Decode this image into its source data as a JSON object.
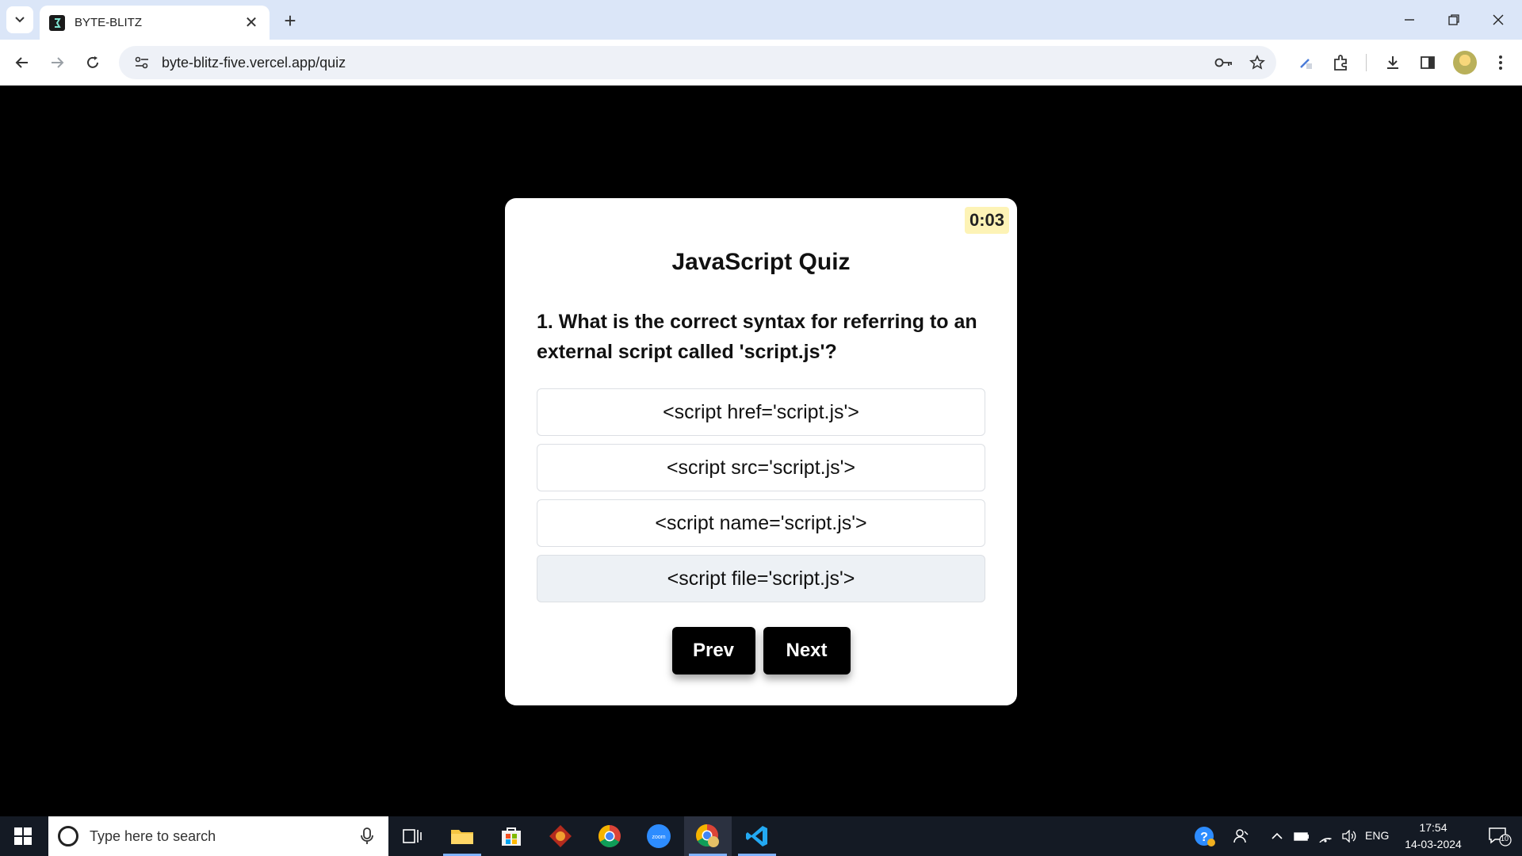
{
  "browser": {
    "tab_title": "BYTE-BLITZ",
    "tab_close": "✕",
    "new_tab": "+",
    "url": "byte-blitz-five.vercel.app/quiz"
  },
  "quiz": {
    "timer": "0:03",
    "title": "JavaScript Quiz",
    "question": "1. What is the correct syntax for referring to an external script called 'script.js'?",
    "options": [
      "<script href='script.js'>",
      "<script src='script.js'>",
      "<script name='script.js'>",
      "<script file='script.js'>"
    ],
    "hovered_option_index": 3,
    "prev_label": "Prev",
    "next_label": "Next"
  },
  "taskbar": {
    "search_placeholder": "Type here to search",
    "language": "ENG",
    "time": "17:54",
    "date": "14-03-2024",
    "notification_count": "10"
  }
}
